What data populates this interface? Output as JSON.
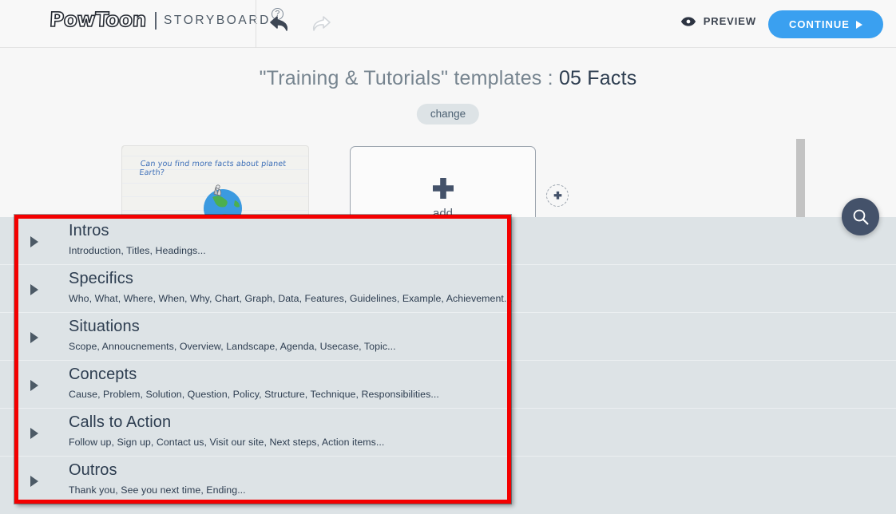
{
  "header": {
    "logo_main": "PowToon",
    "logo_sub": "STORYBOARD",
    "help_badge": "?",
    "undo_icon": "undo-arrow-icon",
    "redo_icon": "redo-arrow-icon",
    "preview_label": "PREVIEW",
    "preview_icon": "eye-icon",
    "continue_label": "CONTINUE",
    "continue_icon": "play-triangle-icon",
    "accent_color": "#3aa0f0"
  },
  "title": {
    "prefix": "\"Training & Tutorials\" templates : ",
    "name": "05 Facts",
    "change_label": "change"
  },
  "strip": {
    "thumbnail_caption": "Can you find more facts about planet Earth?",
    "thumbnail_icon": "earth-globe-icon",
    "add_label": "add",
    "add_icon": "plus-icon",
    "mini_add_icon": "plus-icon",
    "scrollbar": "vertical-scrollbar"
  },
  "search": {
    "icon": "search-icon"
  },
  "categories": [
    {
      "title": "Intros",
      "desc": "Introduction, Titles, Headings...",
      "expand_icon": "chevron-right-icon"
    },
    {
      "title": "Specifics",
      "desc": "Who, What, Where, When, Why, Chart, Graph, Data, Features, Guidelines, Example, Achievement...",
      "expand_icon": "chevron-right-icon"
    },
    {
      "title": "Situations",
      "desc": "Scope, Annoucnements, Overview, Landscape, Agenda, Usecase, Topic...",
      "expand_icon": "chevron-right-icon"
    },
    {
      "title": "Concepts",
      "desc": "Cause, Problem, Solution, Question, Policy, Structure, Technique, Responsibilities...",
      "expand_icon": "chevron-right-icon"
    },
    {
      "title": "Calls to Action",
      "desc": "Follow up, Sign up, Contact us, Visit our site, Next steps, Action items...",
      "expand_icon": "chevron-right-icon"
    },
    {
      "title": "Outros",
      "desc": "Thank you, See you next time, Ending...",
      "expand_icon": "chevron-right-icon"
    }
  ],
  "highlight": {
    "color": "#f40000"
  }
}
